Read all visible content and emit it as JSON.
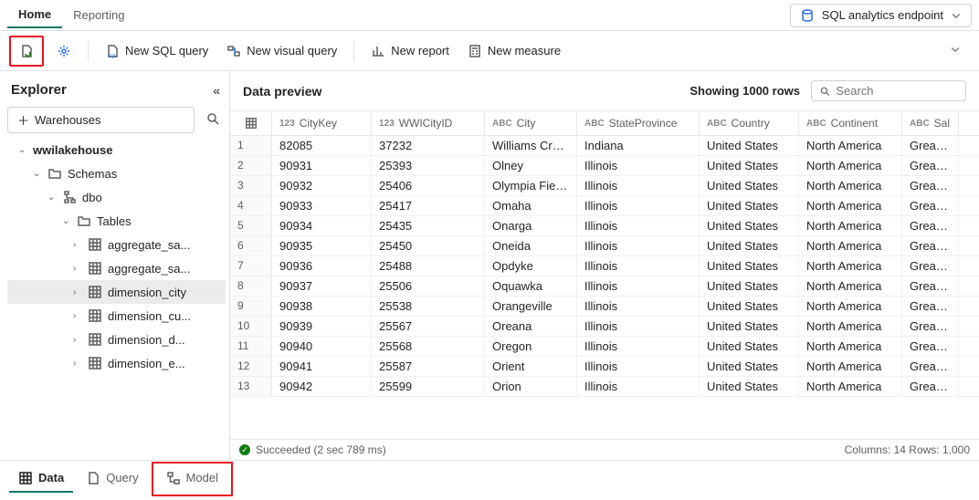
{
  "top_tabs": {
    "home": "Home",
    "reporting": "Reporting"
  },
  "endpoint": {
    "label": "SQL analytics endpoint"
  },
  "ribbon": {
    "new_sql_query": "New SQL query",
    "new_visual_query": "New visual query",
    "new_report": "New report",
    "new_measure": "New measure"
  },
  "explorer": {
    "title": "Explorer",
    "warehouses_btn": "Warehouses",
    "root": "wwilakehouse",
    "schemas": "Schemas",
    "dbo": "dbo",
    "tables": "Tables",
    "items": [
      "aggregate_sa...",
      "aggregate_sa...",
      "dimension_city",
      "dimension_cu...",
      "dimension_d...",
      "dimension_e..."
    ]
  },
  "preview": {
    "title": "Data preview",
    "showing": "Showing 1000 rows",
    "search_placeholder": "Search",
    "columns": [
      {
        "type": "123",
        "label": "CityKey"
      },
      {
        "type": "123",
        "label": "WWICityID"
      },
      {
        "type": "ABC",
        "label": "City"
      },
      {
        "type": "ABC",
        "label": "StateProvince"
      },
      {
        "type": "ABC",
        "label": "Country"
      },
      {
        "type": "ABC",
        "label": "Continent"
      },
      {
        "type": "ABC",
        "label": "Sal"
      }
    ],
    "rows": [
      {
        "n": 1,
        "c": [
          "82085",
          "37232",
          "Williams Creek",
          "Indiana",
          "United States",
          "North America",
          "Great La"
        ]
      },
      {
        "n": 2,
        "c": [
          "90931",
          "25393",
          "Olney",
          "Illinois",
          "United States",
          "North America",
          "Great La"
        ]
      },
      {
        "n": 3,
        "c": [
          "90932",
          "25406",
          "Olympia Fields",
          "Illinois",
          "United States",
          "North America",
          "Great La"
        ]
      },
      {
        "n": 4,
        "c": [
          "90933",
          "25417",
          "Omaha",
          "Illinois",
          "United States",
          "North America",
          "Great La"
        ]
      },
      {
        "n": 5,
        "c": [
          "90934",
          "25435",
          "Onarga",
          "Illinois",
          "United States",
          "North America",
          "Great La"
        ]
      },
      {
        "n": 6,
        "c": [
          "90935",
          "25450",
          "Oneida",
          "Illinois",
          "United States",
          "North America",
          "Great La"
        ]
      },
      {
        "n": 7,
        "c": [
          "90936",
          "25488",
          "Opdyke",
          "Illinois",
          "United States",
          "North America",
          "Great La"
        ]
      },
      {
        "n": 8,
        "c": [
          "90937",
          "25506",
          "Oquawka",
          "Illinois",
          "United States",
          "North America",
          "Great La"
        ]
      },
      {
        "n": 9,
        "c": [
          "90938",
          "25538",
          "Orangeville",
          "Illinois",
          "United States",
          "North America",
          "Great La"
        ]
      },
      {
        "n": 10,
        "c": [
          "90939",
          "25567",
          "Oreana",
          "Illinois",
          "United States",
          "North America",
          "Great La"
        ]
      },
      {
        "n": 11,
        "c": [
          "90940",
          "25568",
          "Oregon",
          "Illinois",
          "United States",
          "North America",
          "Great La"
        ]
      },
      {
        "n": 12,
        "c": [
          "90941",
          "25587",
          "Orient",
          "Illinois",
          "United States",
          "North America",
          "Great La"
        ]
      },
      {
        "n": 13,
        "c": [
          "90942",
          "25599",
          "Orion",
          "Illinois",
          "United States",
          "North America",
          "Great La"
        ]
      }
    ]
  },
  "status": {
    "msg": "Succeeded (2 sec 789 ms)",
    "right": "Columns: 14  Rows: 1,000"
  },
  "bottom_tabs": {
    "data": "Data",
    "query": "Query",
    "model": "Model"
  }
}
